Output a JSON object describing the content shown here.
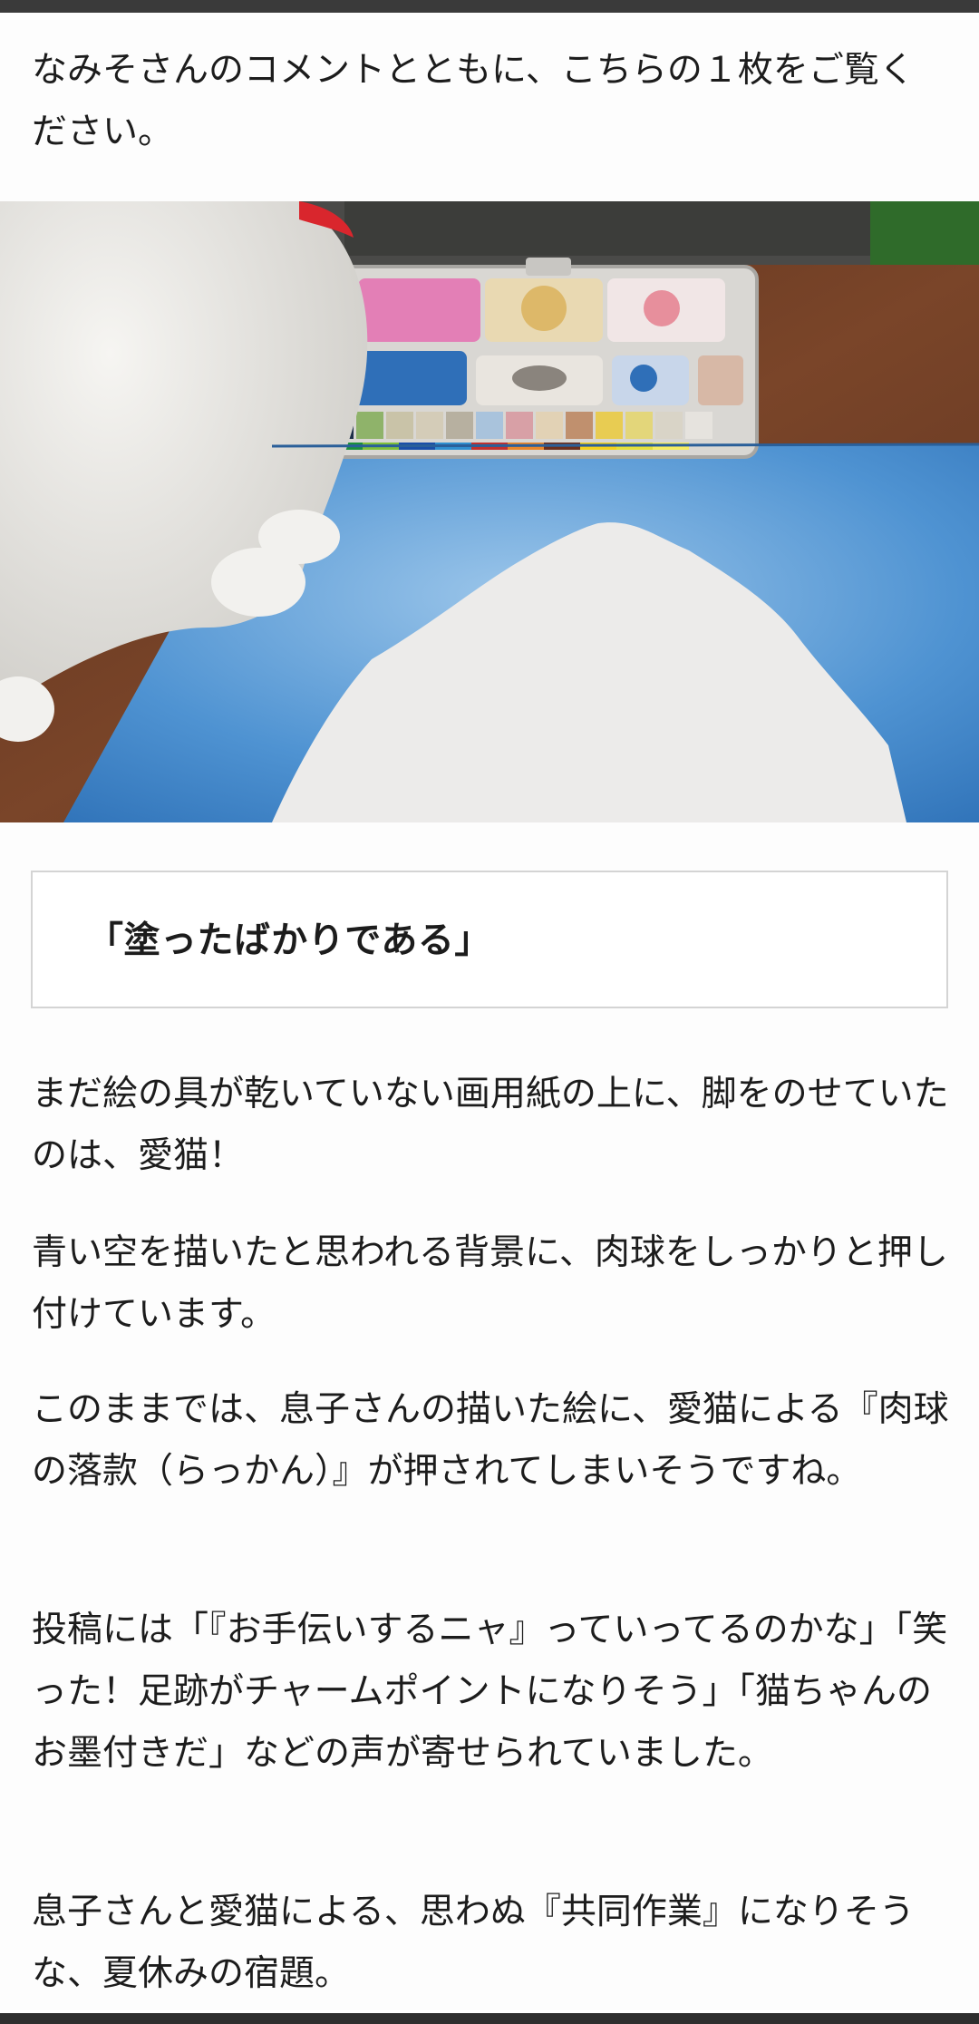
{
  "intro_text": "なみそさんのコメントとともに、こちらの１枚をご覧ください。",
  "photo": {
    "description_icon": "cat-painting-photo"
  },
  "quote": "「塗ったばかりである」",
  "paragraphs": [
    "まだ絵の具が乾いていない画用紙の上に、脚をのせていたのは、愛猫！",
    "青い空を描いたと思われる背景に、肉球をしっかりと押し付けています。",
    "このままでは、息子さんの描いた絵に、愛猫による『肉球の落款（らっかん）』が押されてしまいそうですね。",
    "投稿には「『お手伝いするニャ』っていってるのかな」「笑った！足跡がチャームポイントになりそう」「猫ちゃんのお墨付きだ」などの声が寄せられていました。",
    "息子さんと愛猫による、思わぬ『共同作業』になりそうな、夏休みの宿題。"
  ],
  "colors": {
    "sky_blue": "#4a8fd0",
    "table_brown": "#6b3b24",
    "cat_white": "#ecebe8"
  }
}
